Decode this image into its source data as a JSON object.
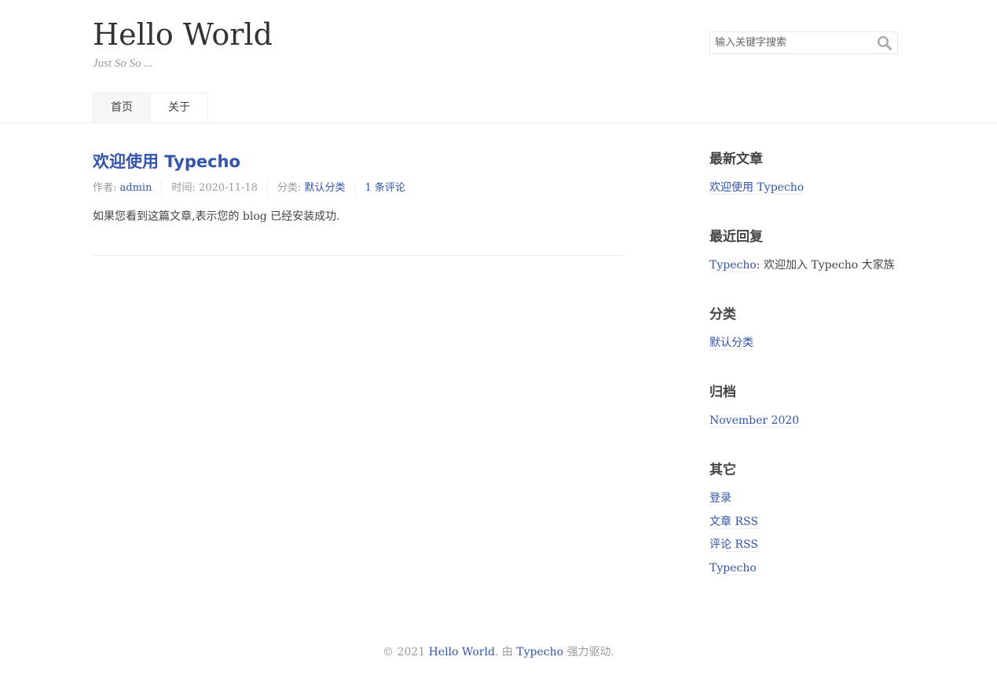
{
  "site": {
    "title": "Hello World",
    "description": "Just So So ..."
  },
  "search": {
    "placeholder": "输入关键字搜索",
    "icon": "search-icon"
  },
  "nav": {
    "items": [
      {
        "label": "首页",
        "current": true
      },
      {
        "label": "关于",
        "current": false
      }
    ]
  },
  "post": {
    "title": "欢迎使用 Typecho",
    "author_label": "作者: ",
    "author": "admin",
    "date_label": "时间: ",
    "date": "2020-11-18",
    "category_label": "分类: ",
    "category": "默认分类",
    "comments": "1 条评论",
    "content": "如果您看到这篇文章,表示您的 blog 已经安装成功."
  },
  "sidebar": {
    "recent_posts": {
      "title": "最新文章",
      "items": [
        "欢迎使用 Typecho"
      ]
    },
    "recent_comments": {
      "title": "最近回复",
      "items": [
        {
          "author": "Typecho",
          "separator": ": ",
          "text": "欢迎加入 Typecho 大家族"
        }
      ]
    },
    "categories": {
      "title": "分类",
      "items": [
        "默认分类"
      ]
    },
    "archives": {
      "title": "归档",
      "items": [
        "November 2020"
      ]
    },
    "other": {
      "title": "其它",
      "items": [
        "登录",
        "文章 RSS",
        "评论 RSS",
        "Typecho"
      ]
    }
  },
  "footer": {
    "copyright": "© 2021 ",
    "site_link": "Hello World",
    "by_text": ". 由 ",
    "engine_link": "Typecho",
    "powered_text": " 强力驱动."
  },
  "colors": {
    "link": "#3354aa",
    "text": "#444444",
    "muted": "#999999",
    "border": "#eeeeee"
  }
}
